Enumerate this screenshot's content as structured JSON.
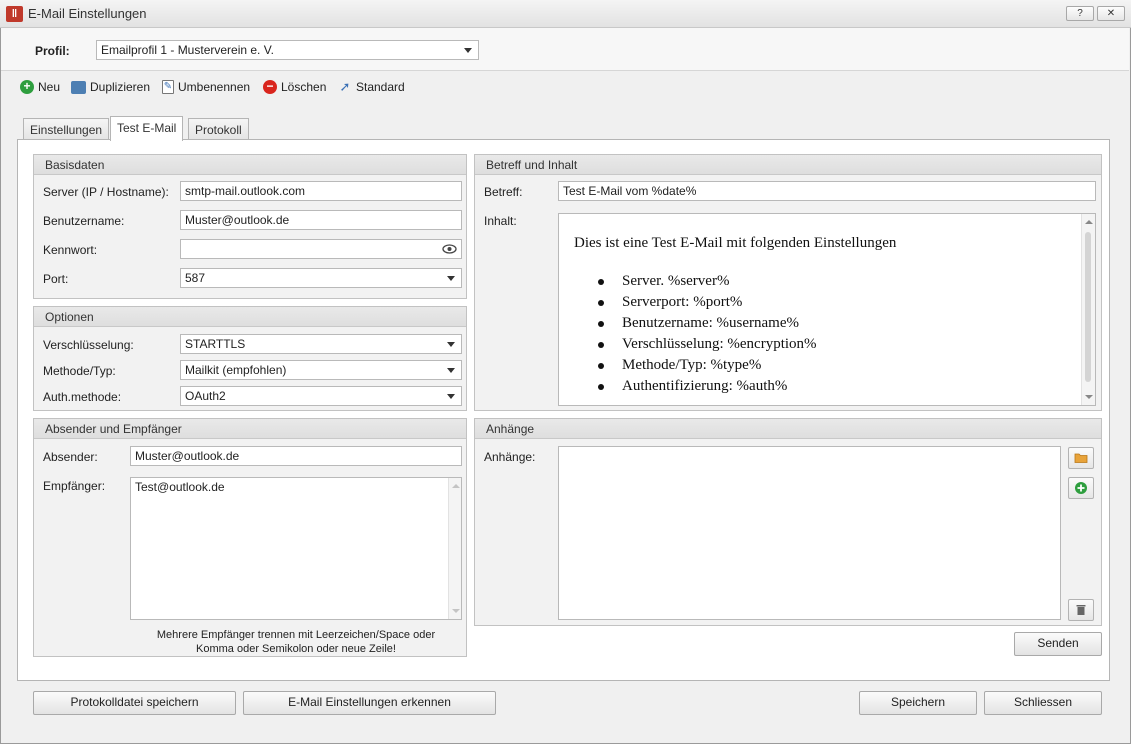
{
  "window": {
    "title": "E-Mail Einstellungen",
    "help_label": "?",
    "close_label": "✕"
  },
  "profile": {
    "label": "Profil:",
    "value": "Emailprofil 1 - Musterverein e. V."
  },
  "toolbar": {
    "new": "Neu",
    "duplicate": "Duplizieren",
    "rename": "Umbenennen",
    "delete": "Löschen",
    "default": "Standard"
  },
  "tabs": [
    {
      "label": "Einstellungen"
    },
    {
      "label": "Test E-Mail",
      "active": true
    },
    {
      "label": "Protokoll"
    }
  ],
  "basisdaten": {
    "title": "Basisdaten",
    "server_label": "Server (IP / Hostname):",
    "server_value": "smtp-mail.outlook.com",
    "user_label": "Benutzername:",
    "user_value": "Muster@outlook.de",
    "password_label": "Kennwort:",
    "password_value": "",
    "port_label": "Port:",
    "port_value": "587"
  },
  "optionen": {
    "title": "Optionen",
    "encryption_label": "Verschlüsselung:",
    "encryption_value": "STARTTLS",
    "method_label": "Methode/Typ:",
    "method_value": "Mailkit (empfohlen)",
    "auth_label": "Auth.methode:",
    "auth_value": "OAuth2"
  },
  "absender": {
    "title": "Absender und Empfänger",
    "sender_label": "Absender:",
    "sender_value": "Muster@outlook.de",
    "recipient_label": "Empfänger:",
    "recipient_value": "Test@outlook.de",
    "hint_line1": "Mehrere Empfänger trennen mit Leerzeichen/Space oder",
    "hint_line2": "Komma oder Semikolon oder neue Zeile!"
  },
  "betreff": {
    "title": "Betreff und Inhalt",
    "subject_label": "Betreff:",
    "subject_value": "Test E-Mail vom %date%",
    "content_label": "Inhalt:",
    "content_intro": "Dies ist eine Test E-Mail mit folgenden Einstellungen",
    "content_items": [
      "Server. %server%",
      "Serverport: %port%",
      "Benutzername: %username%",
      "Verschlüsselung: %encryption%",
      "Methode/Typ: %type%",
      "Authentifizierung: %auth%"
    ]
  },
  "anhaenge": {
    "title": "Anhänge",
    "label": "Anhänge:"
  },
  "buttons": {
    "send": "Senden",
    "save_log": "Protokolldatei speichern",
    "detect": "E-Mail Einstellungen erkennen",
    "save": "Speichern",
    "close": "Schliessen"
  },
  "colors": {
    "add_green": "#2e9e3e",
    "delete_red": "#d9251d",
    "folder_orange": "#e8a33a"
  }
}
